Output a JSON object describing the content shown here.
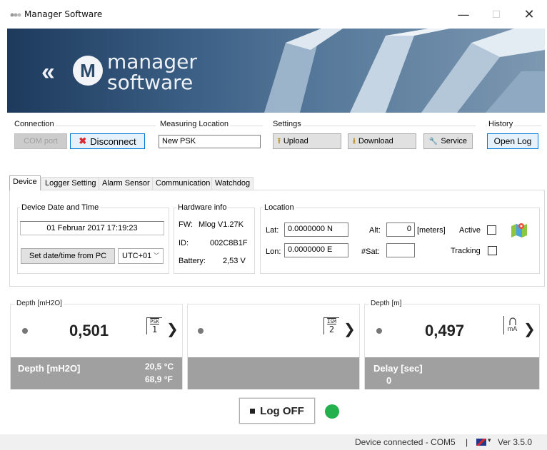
{
  "window": {
    "title": "Manager Software",
    "minimize": "—",
    "maximize": "☐",
    "close": "✕"
  },
  "banner": {
    "logo_letter": "M",
    "logo_word1": "manager",
    "logo_word2": "software"
  },
  "connection": {
    "label": "Connection",
    "com_port_button": "COM port",
    "disconnect_button": "Disconnect"
  },
  "measuring_location": {
    "label": "Measuring Location",
    "value": "New PSK"
  },
  "settings": {
    "label": "Settings",
    "upload": "Upload",
    "download": "Download",
    "service": "Service"
  },
  "history": {
    "label": "History",
    "open_log": "Open Log"
  },
  "tabs": [
    "Device",
    "Logger Setting",
    "Alarm Sensor",
    "Communication",
    "Watchdog"
  ],
  "device_datetime": {
    "label": "Device Date and Time",
    "value": "01 Februar 2017  17:19:23",
    "set_button": "Set date/time from PC",
    "timezone": "UTC+01"
  },
  "hardware": {
    "label": "Hardware info",
    "fw_label": "FW:",
    "fw_value": "Mlog V1.27K",
    "id_label": "ID:",
    "id_value": "002C8B1F",
    "battery_label": "Battery:",
    "battery_value": "2,53 V"
  },
  "location": {
    "label": "Location",
    "lat_label": "Lat:",
    "lat_value": "0.0000000 N",
    "lon_label": "Lon:",
    "lon_value": "0.0000000 E",
    "alt_label": "Alt:",
    "alt_value": "0",
    "alt_unit": "[meters]",
    "sat_label": "#Sat:",
    "sat_value": "",
    "active_label": "Active",
    "tracking_label": "Tracking"
  },
  "cards": [
    {
      "header": "Depth [mH2O]",
      "value": "0,501",
      "sensor_tag": "PSK",
      "sensor_num": "1",
      "foot_label": "Depth [mH2O]",
      "foot_val1": "20,5 °C",
      "foot_val2": "68,9 °F"
    },
    {
      "header": "",
      "value": "",
      "sensor_tag": "ISM",
      "sensor_num": "2",
      "foot_label": "",
      "foot_val1": "",
      "foot_val2": ""
    },
    {
      "header": "Depth  [m]",
      "value": "0,497",
      "sensor_tag": "",
      "sensor_num": "mA",
      "foot_label": "Delay [sec]",
      "foot_val1": "0",
      "foot_val2": ""
    }
  ],
  "log_button": "Log  OFF",
  "log_indicator_color": "#22b14c",
  "status": {
    "text": "Device connected - COM5",
    "separator": "|",
    "version": "Ver 3.5.0"
  }
}
